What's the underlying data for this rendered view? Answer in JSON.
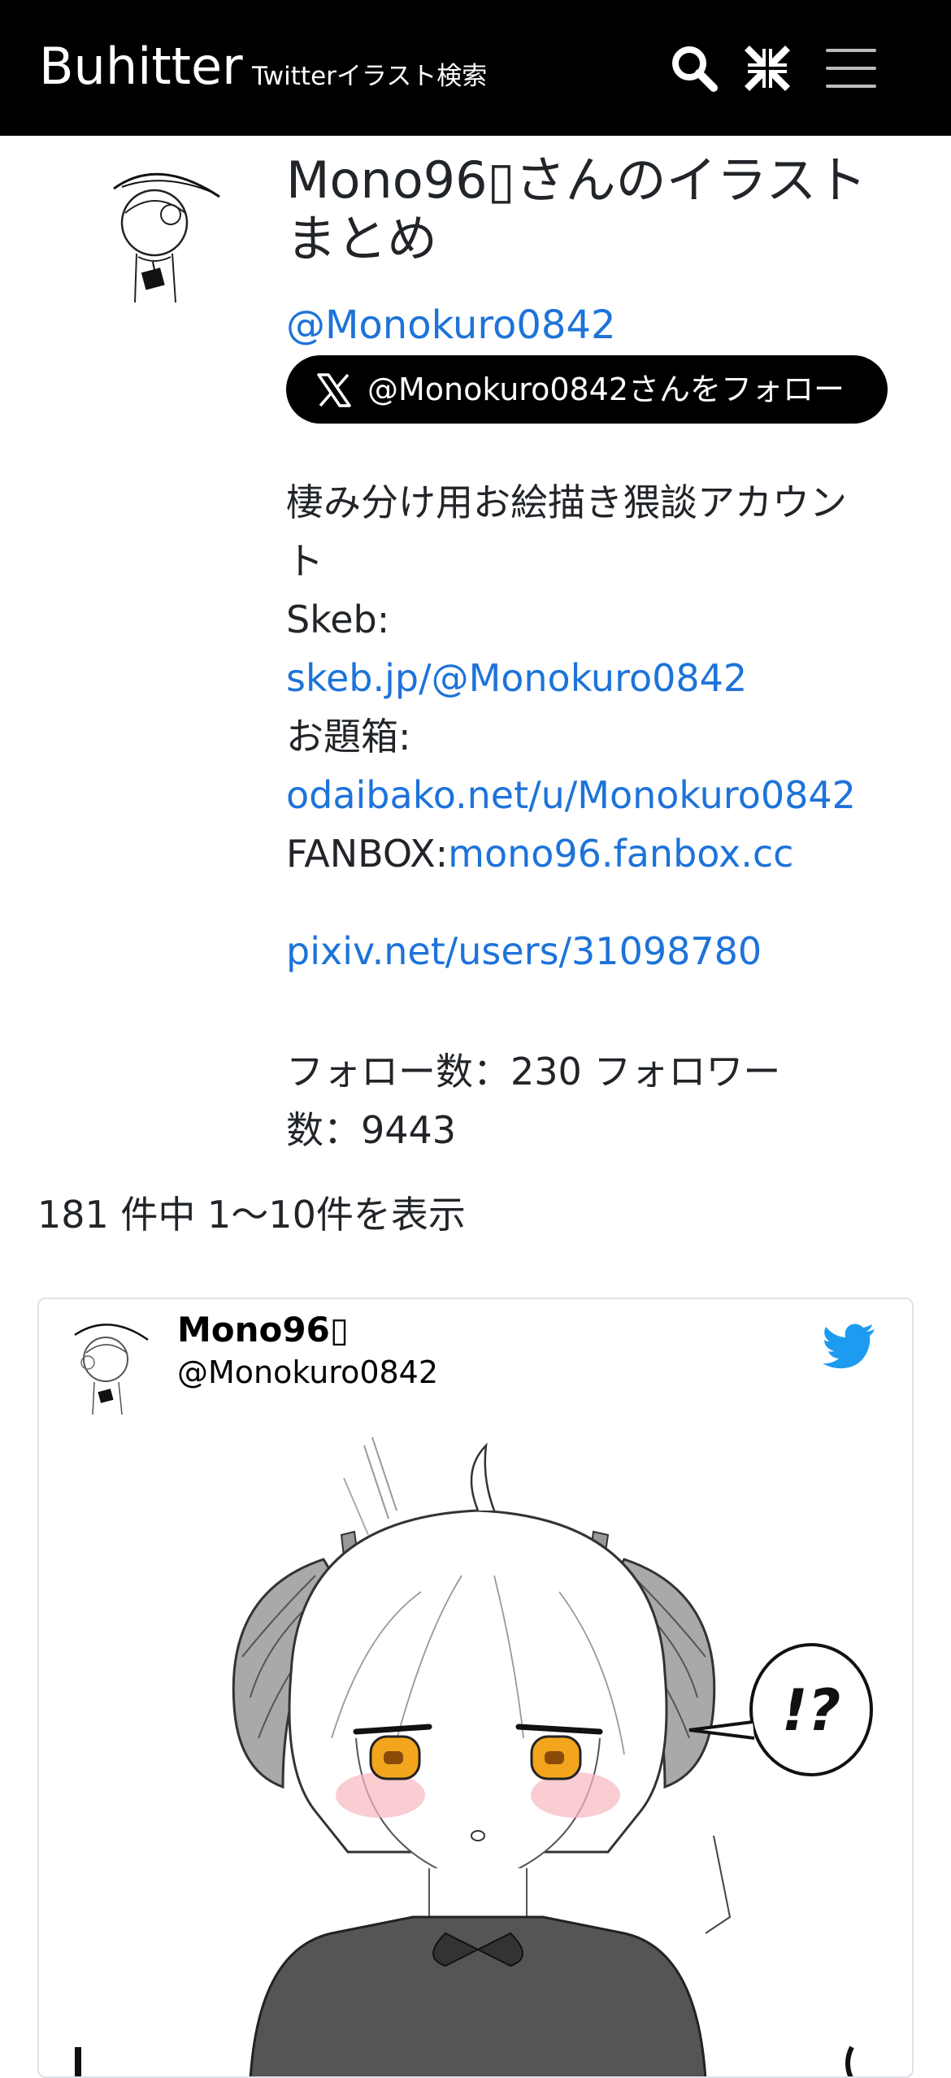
{
  "header": {
    "brand": "Buhitter",
    "tagline": "Twitterイラスト検索",
    "icons": [
      "search-icon",
      "compress-icon",
      "hamburger-menu-icon"
    ]
  },
  "profile": {
    "title_line1": "Mono96▯さんのイラスト",
    "title_line2": "まとめ",
    "handle": "@Monokuro0842",
    "follow_label": "@Monokuro0842さんをフォロー",
    "bio": {
      "line1": "棲み分け用お絵描き猥談アカウン",
      "line2": "ト",
      "skeb_label": "Skeb:",
      "skeb_link": "skeb.jp/@Monokuro0842",
      "odaibako_label": "お題箱:",
      "odaibako_link": "odaibako.net/u/Monokuro0842",
      "fanbox_label": "FANBOX:",
      "fanbox_link": "mono96.fanbox.cc",
      "pixiv_link": "pixiv.net/users/31098780"
    },
    "stats_line1": "フォロー数：230 フォロワー",
    "stats_line2": "数：9443"
  },
  "results": {
    "summary": "181 件中 1〜10件を表示"
  },
  "tweet": {
    "name": "Mono96▯",
    "handle": "@Monokuro0842",
    "speech_text": "!?"
  },
  "colors": {
    "header_bg": "#000000",
    "link": "#1d73d9",
    "twitter_blue": "#1d9bf0",
    "text": "#212529"
  }
}
